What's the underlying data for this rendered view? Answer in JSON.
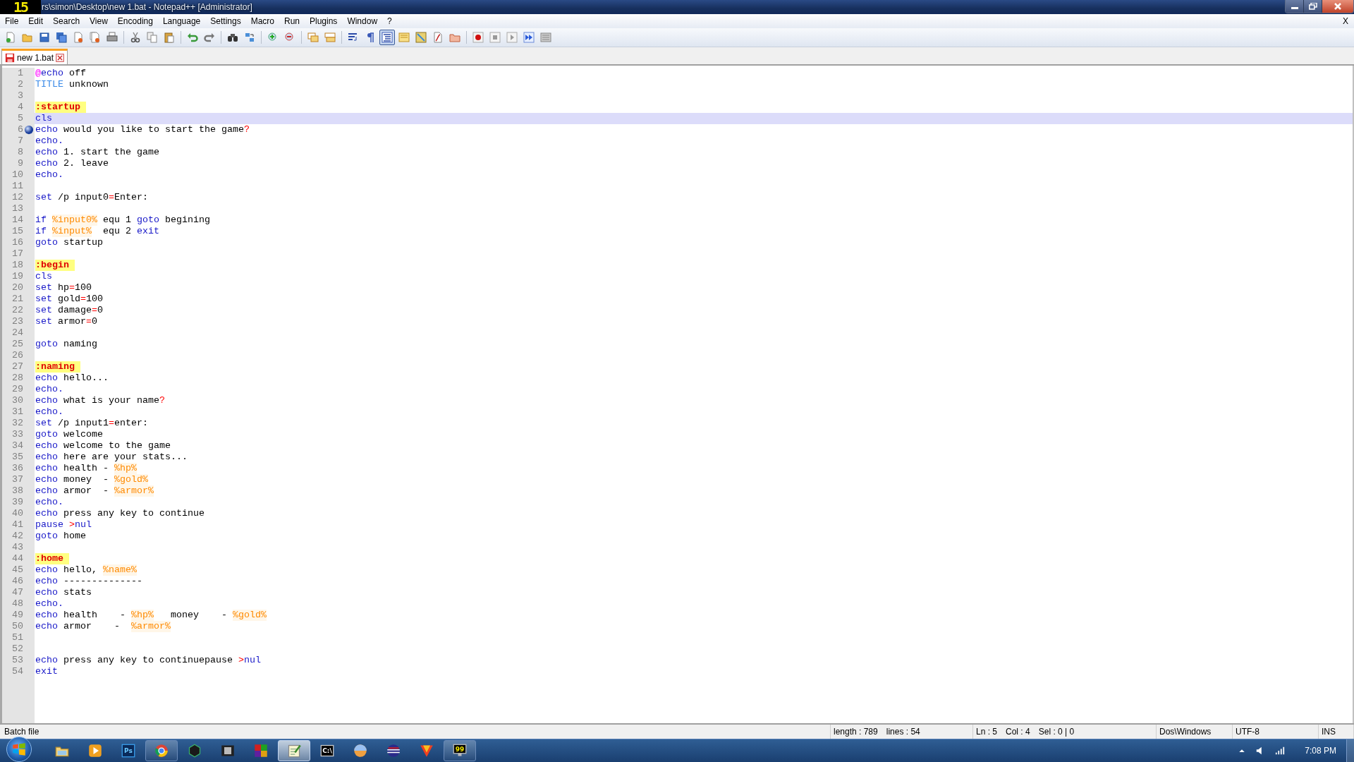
{
  "fps_overlay": "15",
  "window": {
    "title": "rs\\simon\\Desktop\\new 1.bat - Notepad++ [Administrator]"
  },
  "menu": [
    {
      "label": "File"
    },
    {
      "label": "Edit"
    },
    {
      "label": "Search"
    },
    {
      "label": "View"
    },
    {
      "label": "Encoding"
    },
    {
      "label": "Language"
    },
    {
      "label": "Settings"
    },
    {
      "label": "Macro"
    },
    {
      "label": "Run"
    },
    {
      "label": "Plugins"
    },
    {
      "label": "Window"
    },
    {
      "label": "?"
    }
  ],
  "close_document": "X",
  "toolbar": [
    {
      "kind": "new",
      "pressed": false
    },
    {
      "kind": "open",
      "pressed": false
    },
    {
      "kind": "save",
      "pressed": false
    },
    {
      "kind": "save-all",
      "pressed": false
    },
    {
      "kind": "close",
      "pressed": false
    },
    {
      "kind": "close-all",
      "pressed": false
    },
    {
      "kind": "print",
      "pressed": false
    },
    {
      "kind": "separator"
    },
    {
      "kind": "cut",
      "pressed": false
    },
    {
      "kind": "copy",
      "pressed": false
    },
    {
      "kind": "paste",
      "pressed": false
    },
    {
      "kind": "separator"
    },
    {
      "kind": "undo",
      "pressed": false
    },
    {
      "kind": "redo",
      "pressed": false
    },
    {
      "kind": "separator"
    },
    {
      "kind": "find",
      "pressed": false
    },
    {
      "kind": "replace",
      "pressed": false
    },
    {
      "kind": "separator"
    },
    {
      "kind": "zoom-in",
      "pressed": false
    },
    {
      "kind": "zoom-out",
      "pressed": false
    },
    {
      "kind": "separator"
    },
    {
      "kind": "sync-v",
      "pressed": false
    },
    {
      "kind": "sync-h",
      "pressed": false
    },
    {
      "kind": "separator"
    },
    {
      "kind": "wrap",
      "pressed": false
    },
    {
      "kind": "pilcrow",
      "pressed": false
    },
    {
      "kind": "indent",
      "pressed": true
    },
    {
      "kind": "udl",
      "pressed": false
    },
    {
      "kind": "map",
      "pressed": false
    },
    {
      "kind": "function",
      "pressed": false
    },
    {
      "kind": "folder",
      "pressed": false
    },
    {
      "kind": "separator"
    },
    {
      "kind": "record",
      "pressed": false
    },
    {
      "kind": "stop",
      "pressed": false
    },
    {
      "kind": "play",
      "pressed": false
    },
    {
      "kind": "play-multi",
      "pressed": false
    },
    {
      "kind": "save-macro",
      "pressed": false
    }
  ],
  "tabs": [
    {
      "label": "new 1.bat",
      "selected": true
    }
  ],
  "editor": {
    "lines": [
      {
        "number": "1",
        "selected": false,
        "bookmark": false,
        "tokens": [
          {
            "kind": "at",
            "text": "@"
          },
          {
            "kind": "keyword",
            "text": "echo"
          },
          {
            "kind": "plain",
            "text": " off"
          }
        ]
      },
      {
        "number": "2",
        "selected": false,
        "bookmark": false,
        "tokens": [
          {
            "kind": "command",
            "text": "TITLE"
          },
          {
            "kind": "plain",
            "text": " unknown"
          }
        ]
      },
      {
        "number": "3",
        "selected": false,
        "bookmark": false
      },
      {
        "number": "4",
        "selected": false,
        "bookmark": false,
        "tokens": [
          {
            "kind": "label",
            "text": ":startup"
          }
        ]
      },
      {
        "number": "5",
        "selected": true,
        "bookmark": false,
        "tokens": [
          {
            "kind": "keyword",
            "text": "cls"
          }
        ]
      },
      {
        "number": "6",
        "selected": false,
        "bookmark": true,
        "tokens": [
          {
            "kind": "keyword",
            "text": "echo"
          },
          {
            "kind": "plain",
            "text": " would you like to start the game"
          },
          {
            "kind": "operator",
            "text": "?"
          }
        ]
      },
      {
        "number": "7",
        "selected": false,
        "bookmark": false,
        "tokens": [
          {
            "kind": "keyword",
            "text": "echo."
          }
        ]
      },
      {
        "number": "8",
        "selected": false,
        "bookmark": false,
        "tokens": [
          {
            "kind": "keyword",
            "text": "echo"
          },
          {
            "kind": "plain",
            "text": " 1. start the game"
          }
        ]
      },
      {
        "number": "9",
        "selected": false,
        "bookmark": false,
        "tokens": [
          {
            "kind": "keyword",
            "text": "echo"
          },
          {
            "kind": "plain",
            "text": " 2. leave"
          }
        ]
      },
      {
        "number": "10",
        "selected": false,
        "bookmark": false,
        "tokens": [
          {
            "kind": "keyword",
            "text": "echo."
          }
        ]
      },
      {
        "number": "11",
        "selected": false,
        "bookmark": false
      },
      {
        "number": "12",
        "selected": false,
        "bookmark": false,
        "tokens": [
          {
            "kind": "keyword",
            "text": "set"
          },
          {
            "kind": "plain",
            "text": " /p input0"
          },
          {
            "kind": "operator",
            "text": "="
          },
          {
            "kind": "plain",
            "text": "Enter:"
          }
        ]
      },
      {
        "number": "13",
        "selected": false,
        "bookmark": false
      },
      {
        "number": "14",
        "selected": false,
        "bookmark": false,
        "tokens": [
          {
            "kind": "keyword",
            "text": "if "
          },
          {
            "kind": "variable",
            "text": "%input0%"
          },
          {
            "kind": "plain",
            "text": " equ 1 "
          },
          {
            "kind": "keyword",
            "text": "goto"
          },
          {
            "kind": "plain",
            "text": " begining"
          }
        ]
      },
      {
        "number": "15",
        "selected": false,
        "bookmark": false,
        "tokens": [
          {
            "kind": "keyword",
            "text": "if "
          },
          {
            "kind": "variable",
            "text": "%input%"
          },
          {
            "kind": "plain",
            "text": "  equ 2 "
          },
          {
            "kind": "keyword",
            "text": "exit"
          }
        ]
      },
      {
        "number": "16",
        "selected": false,
        "bookmark": false,
        "tokens": [
          {
            "kind": "keyword",
            "text": "goto"
          },
          {
            "kind": "plain",
            "text": " startup"
          }
        ]
      },
      {
        "number": "17",
        "selected": false,
        "bookmark": false
      },
      {
        "number": "18",
        "selected": false,
        "bookmark": false,
        "tokens": [
          {
            "kind": "label",
            "text": ":begin"
          }
        ]
      },
      {
        "number": "19",
        "selected": false,
        "bookmark": false,
        "tokens": [
          {
            "kind": "keyword",
            "text": "cls"
          }
        ]
      },
      {
        "number": "20",
        "selected": false,
        "bookmark": false,
        "tokens": [
          {
            "kind": "keyword",
            "text": "set"
          },
          {
            "kind": "plain",
            "text": " hp"
          },
          {
            "kind": "operator",
            "text": "="
          },
          {
            "kind": "plain",
            "text": "100"
          }
        ]
      },
      {
        "number": "21",
        "selected": false,
        "bookmark": false,
        "tokens": [
          {
            "kind": "keyword",
            "text": "set"
          },
          {
            "kind": "plain",
            "text": " gold"
          },
          {
            "kind": "operator",
            "text": "="
          },
          {
            "kind": "plain",
            "text": "100"
          }
        ]
      },
      {
        "number": "22",
        "selected": false,
        "bookmark": false,
        "tokens": [
          {
            "kind": "keyword",
            "text": "set"
          },
          {
            "kind": "plain",
            "text": " damage"
          },
          {
            "kind": "operator",
            "text": "="
          },
          {
            "kind": "plain",
            "text": "0"
          }
        ]
      },
      {
        "number": "23",
        "selected": false,
        "bookmark": false,
        "tokens": [
          {
            "kind": "keyword",
            "text": "set"
          },
          {
            "kind": "plain",
            "text": " armor"
          },
          {
            "kind": "operator",
            "text": "="
          },
          {
            "kind": "plain",
            "text": "0"
          }
        ]
      },
      {
        "number": "24",
        "selected": false,
        "bookmark": false
      },
      {
        "number": "25",
        "selected": false,
        "bookmark": false,
        "tokens": [
          {
            "kind": "keyword",
            "text": "goto"
          },
          {
            "kind": "plain",
            "text": " naming"
          }
        ]
      },
      {
        "number": "26",
        "selected": false,
        "bookmark": false
      },
      {
        "number": "27",
        "selected": false,
        "bookmark": false,
        "tokens": [
          {
            "kind": "label",
            "text": ":naming"
          }
        ]
      },
      {
        "number": "28",
        "selected": false,
        "bookmark": false,
        "tokens": [
          {
            "kind": "keyword",
            "text": "echo"
          },
          {
            "kind": "plain",
            "text": " hello..."
          }
        ]
      },
      {
        "number": "29",
        "selected": false,
        "bookmark": false,
        "tokens": [
          {
            "kind": "keyword",
            "text": "echo."
          }
        ]
      },
      {
        "number": "30",
        "selected": false,
        "bookmark": false,
        "tokens": [
          {
            "kind": "keyword",
            "text": "echo"
          },
          {
            "kind": "plain",
            "text": " what is your name"
          },
          {
            "kind": "operator",
            "text": "?"
          }
        ]
      },
      {
        "number": "31",
        "selected": false,
        "bookmark": false,
        "tokens": [
          {
            "kind": "keyword",
            "text": "echo."
          }
        ]
      },
      {
        "number": "32",
        "selected": false,
        "bookmark": false,
        "tokens": [
          {
            "kind": "keyword",
            "text": "set"
          },
          {
            "kind": "plain",
            "text": " /p input1"
          },
          {
            "kind": "operator",
            "text": "="
          },
          {
            "kind": "plain",
            "text": "enter:"
          }
        ]
      },
      {
        "number": "33",
        "selected": false,
        "bookmark": false,
        "tokens": [
          {
            "kind": "keyword",
            "text": "goto"
          },
          {
            "kind": "plain",
            "text": " welcome"
          }
        ]
      },
      {
        "number": "34",
        "selected": false,
        "bookmark": false,
        "tokens": [
          {
            "kind": "keyword",
            "text": "echo"
          },
          {
            "kind": "plain",
            "text": " welcome to the game"
          }
        ]
      },
      {
        "number": "35",
        "selected": false,
        "bookmark": false,
        "tokens": [
          {
            "kind": "keyword",
            "text": "echo"
          },
          {
            "kind": "plain",
            "text": " here are your stats..."
          }
        ]
      },
      {
        "number": "36",
        "selected": false,
        "bookmark": false,
        "tokens": [
          {
            "kind": "keyword",
            "text": "echo"
          },
          {
            "kind": "plain",
            "text": " health - "
          },
          {
            "kind": "variable",
            "text": "%hp%"
          }
        ]
      },
      {
        "number": "37",
        "selected": false,
        "bookmark": false,
        "tokens": [
          {
            "kind": "keyword",
            "text": "echo"
          },
          {
            "kind": "plain",
            "text": " money  - "
          },
          {
            "kind": "variable",
            "text": "%gold%"
          }
        ]
      },
      {
        "number": "38",
        "selected": false,
        "bookmark": false,
        "tokens": [
          {
            "kind": "keyword",
            "text": "echo"
          },
          {
            "kind": "plain",
            "text": " armor  - "
          },
          {
            "kind": "variable",
            "text": "%armor%"
          }
        ]
      },
      {
        "number": "39",
        "selected": false,
        "bookmark": false,
        "tokens": [
          {
            "kind": "keyword",
            "text": "echo."
          }
        ]
      },
      {
        "number": "40",
        "selected": false,
        "bookmark": false,
        "tokens": [
          {
            "kind": "keyword",
            "text": "echo"
          },
          {
            "kind": "plain",
            "text": " press any key to continue"
          }
        ]
      },
      {
        "number": "41",
        "selected": false,
        "bookmark": false,
        "tokens": [
          {
            "kind": "keyword",
            "text": "pause "
          },
          {
            "kind": "operator",
            "text": ">"
          },
          {
            "kind": "keyword",
            "text": "nul"
          }
        ]
      },
      {
        "number": "42",
        "selected": false,
        "bookmark": false,
        "tokens": [
          {
            "kind": "keyword",
            "text": "goto"
          },
          {
            "kind": "plain",
            "text": " home"
          }
        ]
      },
      {
        "number": "43",
        "selected": false,
        "bookmark": false
      },
      {
        "number": "44",
        "selected": false,
        "bookmark": false,
        "tokens": [
          {
            "kind": "label",
            "text": ":home"
          }
        ]
      },
      {
        "number": "45",
        "selected": false,
        "bookmark": false,
        "tokens": [
          {
            "kind": "keyword",
            "text": "echo"
          },
          {
            "kind": "plain",
            "text": " hello, "
          },
          {
            "kind": "variable",
            "text": "%name%"
          }
        ]
      },
      {
        "number": "46",
        "selected": false,
        "bookmark": false,
        "tokens": [
          {
            "kind": "keyword",
            "text": "echo"
          },
          {
            "kind": "plain",
            "text": " --------------"
          }
        ]
      },
      {
        "number": "47",
        "selected": false,
        "bookmark": false,
        "tokens": [
          {
            "kind": "keyword",
            "text": "echo"
          },
          {
            "kind": "plain",
            "text": " stats"
          }
        ]
      },
      {
        "number": "48",
        "selected": false,
        "bookmark": false,
        "tokens": [
          {
            "kind": "keyword",
            "text": "echo."
          }
        ]
      },
      {
        "number": "49",
        "selected": false,
        "bookmark": false,
        "tokens": [
          {
            "kind": "keyword",
            "text": "echo"
          },
          {
            "kind": "plain",
            "text": " health    - "
          },
          {
            "kind": "variable",
            "text": "%hp%"
          },
          {
            "kind": "plain",
            "text": "   money    - "
          },
          {
            "kind": "variable",
            "text": "%gold%"
          }
        ]
      },
      {
        "number": "50",
        "selected": false,
        "bookmark": false,
        "tokens": [
          {
            "kind": "keyword",
            "text": "echo"
          },
          {
            "kind": "plain",
            "text": " armor    -  "
          },
          {
            "kind": "variable",
            "text": "%armor%"
          }
        ]
      },
      {
        "number": "51",
        "selected": false,
        "bookmark": false
      },
      {
        "number": "52",
        "selected": false,
        "bookmark": false
      },
      {
        "number": "53",
        "selected": false,
        "bookmark": false,
        "tokens": [
          {
            "kind": "keyword",
            "text": "echo"
          },
          {
            "kind": "plain",
            "text": " press any key to continuepause "
          },
          {
            "kind": "operator",
            "text": ">"
          },
          {
            "kind": "keyword",
            "text": "nul"
          }
        ]
      },
      {
        "number": "54",
        "selected": false,
        "bookmark": false,
        "tokens": [
          {
            "kind": "keyword",
            "text": "exit"
          }
        ]
      }
    ]
  },
  "status_bar": {
    "file_type": "Batch file",
    "length": "length : 789",
    "lines": "lines : 54",
    "line": "Ln : 5",
    "column": "Col : 4",
    "selection": "Sel : 0 | 0",
    "eol": "Dos\\Windows",
    "encoding": "UTF-8",
    "mode": "INS"
  },
  "taskbar": {
    "apps": [
      {
        "kind": "folder",
        "open": false,
        "active": false
      },
      {
        "kind": "media",
        "open": false,
        "active": false
      },
      {
        "kind": "ps",
        "label": "Ps",
        "open": false,
        "active": false
      },
      {
        "kind": "browser",
        "open": true,
        "active": false
      },
      {
        "kind": "nox",
        "open": false,
        "active": false
      },
      {
        "kind": "film",
        "open": false,
        "active": false
      },
      {
        "kind": "tiles",
        "open": false,
        "active": false
      },
      {
        "kind": "notepad",
        "open": true,
        "active": true
      },
      {
        "kind": "console",
        "label": "C:\\",
        "open": false,
        "active": false
      },
      {
        "kind": "sphere",
        "open": false,
        "active": false
      },
      {
        "kind": "globe",
        "open": false,
        "active": false
      },
      {
        "kind": "triangle",
        "open": false,
        "active": false
      },
      {
        "kind": "monitor",
        "label": "99",
        "open": true,
        "active": false
      }
    ],
    "clock": "7:08 PM"
  }
}
